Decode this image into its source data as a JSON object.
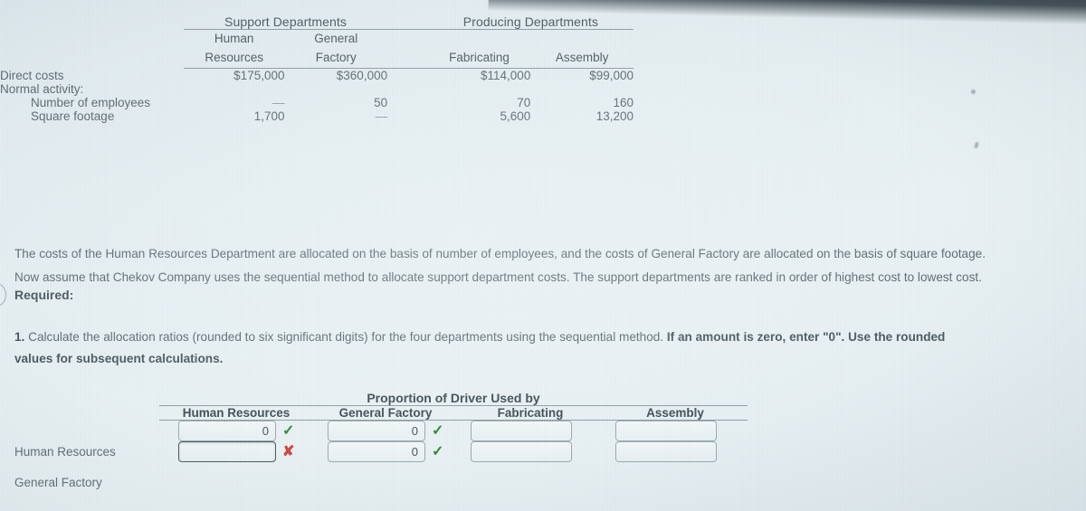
{
  "cost_table": {
    "group_headers": [
      {
        "label": "Support Departments"
      },
      {
        "label": "Producing Departments"
      }
    ],
    "columns": [
      {
        "line1": "Human",
        "line2": "Resources"
      },
      {
        "line1": "General",
        "line2": "Factory"
      },
      {
        "line1": "",
        "line2": "Fabricating"
      },
      {
        "line1": "",
        "line2": "Assembly"
      }
    ],
    "rows": [
      {
        "label": "Direct costs",
        "indent": false,
        "values": [
          "$175,000",
          "$360,000",
          "$114,000",
          "$99,000"
        ]
      },
      {
        "label": "Normal activity:",
        "indent": false,
        "values": [
          "",
          "",
          "",
          ""
        ]
      },
      {
        "label": "Number of employees",
        "indent": true,
        "values": [
          "—",
          "50",
          "70",
          "160"
        ]
      },
      {
        "label": "Square footage",
        "indent": true,
        "values": [
          "1,700",
          "—",
          "5,600",
          "13,200"
        ]
      }
    ]
  },
  "narrative": {
    "line1": "The costs of the Human Resources Department are allocated on the basis of number of employees, and the costs of General Factory are allocated on the basis of square footage.",
    "line2": "Now assume that Chekov Company uses the sequential method to allocate support department costs. The support departments are ranked in order of highest cost to lowest cost.",
    "required_label": "Required:"
  },
  "question": {
    "number": "1.",
    "text_normal_1": "Calculate the allocation ratios (rounded to six significant digits) for the four departments using the sequential method.",
    "text_bold_1": "If an amount is zero, enter \"0\". Use the rounded",
    "text_bold_2": "values for subsequent calculations."
  },
  "answer_table": {
    "title": "Proportion of Driver Used by",
    "columns": [
      "Human Resources",
      "General Factory",
      "Fabricating",
      "Assembly"
    ],
    "rows": [
      {
        "label": "Human Resources",
        "cells": [
          {
            "value": "0",
            "mark": "check",
            "focused": false
          },
          {
            "value": "0",
            "mark": "check",
            "focused": false
          },
          {
            "value": "",
            "mark": "none",
            "focused": false
          },
          {
            "value": "",
            "mark": "none",
            "focused": false
          }
        ]
      },
      {
        "label": "General Factory",
        "cells": [
          {
            "value": "",
            "mark": "cross",
            "focused": true
          },
          {
            "value": "0",
            "mark": "check",
            "focused": false
          },
          {
            "value": "",
            "mark": "none",
            "focused": false
          },
          {
            "value": "",
            "mark": "none",
            "focused": false
          }
        ]
      }
    ],
    "marks": {
      "check": "✓",
      "cross": "✘",
      "none": ""
    },
    "colors": {
      "check": "#2e8b36",
      "cross": "#d0453a"
    }
  }
}
